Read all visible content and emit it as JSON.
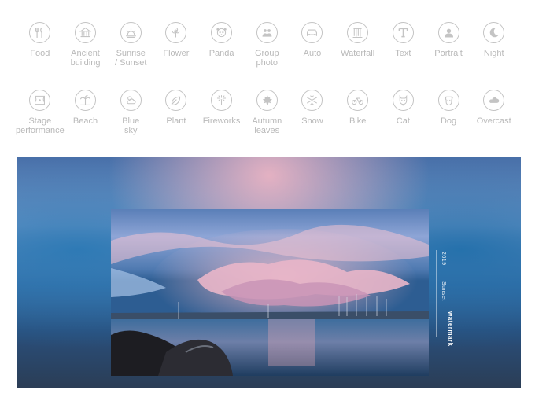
{
  "scene_modes": [
    {
      "label": "Food",
      "icon": "fork-knife-icon"
    },
    {
      "label": "Ancient\nbuilding",
      "icon": "temple-icon"
    },
    {
      "label": "Sunrise\n/ Sunset",
      "icon": "sunrise-icon"
    },
    {
      "label": "Flower",
      "icon": "flower-icon"
    },
    {
      "label": "Panda",
      "icon": "panda-icon"
    },
    {
      "label": "Group\nphoto",
      "icon": "group-icon"
    },
    {
      "label": "Auto",
      "icon": "car-icon"
    },
    {
      "label": "Waterfall",
      "icon": "waterfall-icon"
    },
    {
      "label": "Text",
      "icon": "text-icon"
    },
    {
      "label": "Portrait",
      "icon": "portrait-icon"
    },
    {
      "label": "Night",
      "icon": "moon-icon"
    },
    {
      "label": "Stage\nperformance",
      "icon": "stage-icon"
    },
    {
      "label": "Beach",
      "icon": "palm-tree-icon"
    },
    {
      "label": "Blue\nsky",
      "icon": "sun-cloud-icon"
    },
    {
      "label": "Plant",
      "icon": "leaf-icon"
    },
    {
      "label": "Fireworks",
      "icon": "fireworks-icon"
    },
    {
      "label": "Autumn\nleaves",
      "icon": "maple-leaf-icon"
    },
    {
      "label": "Snow",
      "icon": "snowflake-icon"
    },
    {
      "label": "Bike",
      "icon": "bicycle-icon"
    },
    {
      "label": "Cat",
      "icon": "cat-icon"
    },
    {
      "label": "Dog",
      "icon": "dog-icon"
    },
    {
      "label": "Overcast",
      "icon": "cloud-icon"
    }
  ],
  "preview": {
    "side_title": "watermark",
    "side_sub1": "Sunset",
    "side_sub2": "2019"
  },
  "colors": {
    "icon_stroke": "#c4c4c4",
    "label_text": "#b9b9b9"
  }
}
